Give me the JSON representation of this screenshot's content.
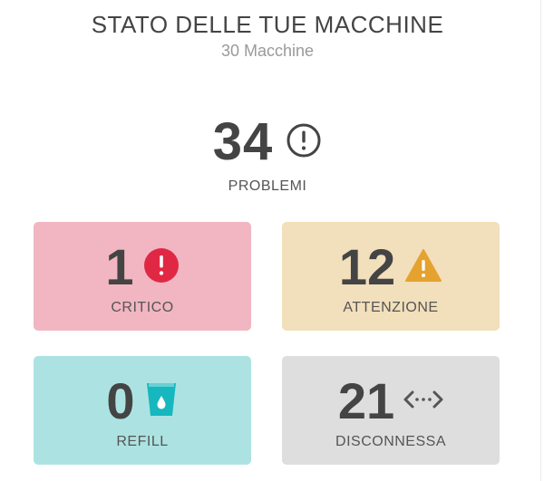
{
  "header": {
    "title": "STATO DELLE TUE MACCHINE",
    "subtitle": "30 Macchine"
  },
  "summary": {
    "total": "34",
    "total_label": "PROBLEMI",
    "icon": "alert-circle-icon"
  },
  "cards": {
    "critical": {
      "count": "1",
      "label": "CRITICO",
      "icon": "critical-alert-icon",
      "color": "#f1b6c2",
      "icon_color": "#e02845"
    },
    "warning": {
      "count": "12",
      "label": "ATTENZIONE",
      "icon": "warning-triangle-icon",
      "color": "#f2dfbb",
      "icon_color": "#e5a22f"
    },
    "refill": {
      "count": "0",
      "label": "REFILL",
      "icon": "water-cup-icon",
      "color": "#ace3e2",
      "icon_color": "#17b7bf"
    },
    "disconnected": {
      "count": "21",
      "label": "DISCONNESSA",
      "icon": "disconnected-arrows-icon",
      "color": "#dedede",
      "icon_color": "#555555"
    }
  }
}
